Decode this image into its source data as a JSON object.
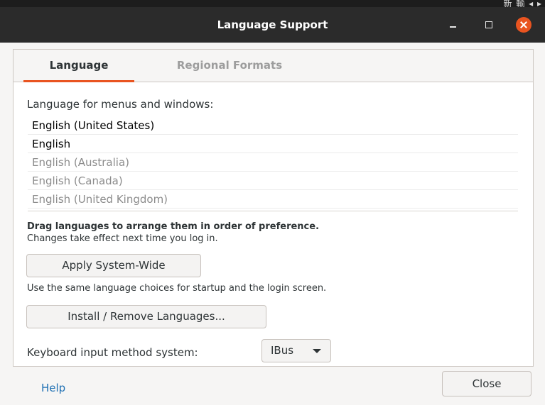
{
  "topbar": {
    "glyphs": "新 輸 ◂ ▸"
  },
  "window": {
    "title": "Language Support"
  },
  "tabs": [
    {
      "label": "Language"
    },
    {
      "label": "Regional Formats"
    }
  ],
  "language": {
    "menus_label": "Language for menus and windows:",
    "items": [
      {
        "label": "English (United States)",
        "state": "active"
      },
      {
        "label": "English",
        "state": "active"
      },
      {
        "label": "English (Australia)",
        "state": "inactive"
      },
      {
        "label": "English (Canada)",
        "state": "inactive"
      },
      {
        "label": "English (United Kingdom)",
        "state": "inactive"
      }
    ],
    "drag_hint": "Drag languages to arrange them in order of preference.",
    "effect_hint": "Changes take effect next time you log in.",
    "apply_button": "Apply System-Wide",
    "system_hint": "Use the same language choices for startup and the login screen.",
    "install_button": "Install / Remove Languages...",
    "keyboard_label": "Keyboard input method system:",
    "keyboard_value": "IBus"
  },
  "footer": {
    "help_label": "Help",
    "close_label": "Close"
  },
  "colors": {
    "accent": "#e95420",
    "link": "#1d6fb3",
    "titlebar": "#2b2b2b"
  }
}
